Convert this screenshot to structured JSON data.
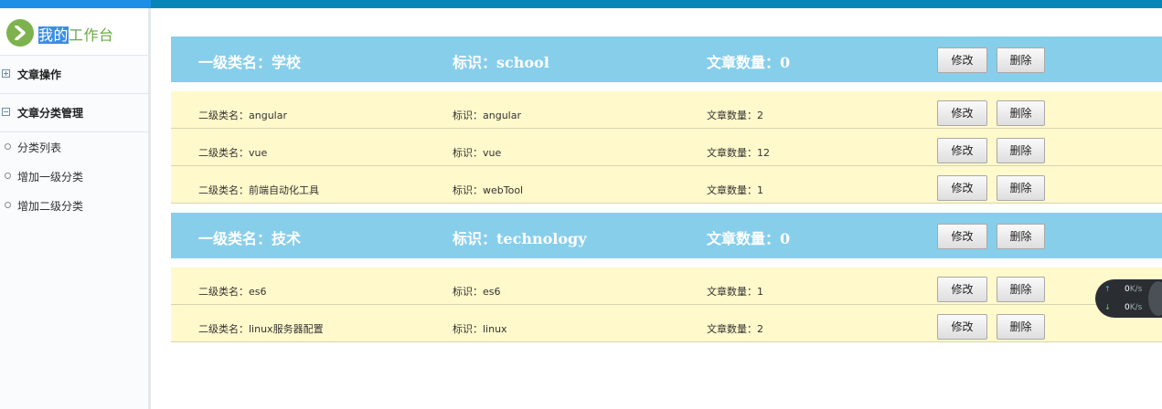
{
  "brand": {
    "selected": "我的",
    "rest": "工作台"
  },
  "sidebar": {
    "groups": [
      {
        "label": "文章操作",
        "state": "collapsed"
      },
      {
        "label": "文章分类管理",
        "state": "expanded"
      }
    ],
    "items": [
      {
        "label": "分类列表"
      },
      {
        "label": "增加一级分类"
      },
      {
        "label": "增加二级分类"
      }
    ]
  },
  "buttons": {
    "edit": "修改",
    "delete": "删除"
  },
  "categories": [
    {
      "name": "一级类名：学校",
      "tag": "标识：school",
      "count": "文章数量：0",
      "children": [
        {
          "name": "二级类名：angular",
          "tag": "标识：angular",
          "count": "文章数量：2"
        },
        {
          "name": "二级类名：vue",
          "tag": "标识：vue",
          "count": "文章数量：12"
        },
        {
          "name": "二级类名：前端自动化工具",
          "tag": "标识：webTool",
          "count": "文章数量：1"
        }
      ]
    },
    {
      "name": "一级类名：技术",
      "tag": "标识：technology",
      "count": "文章数量：0",
      "children": [
        {
          "name": "二级类名：es6",
          "tag": "标识：es6",
          "count": "文章数量：1"
        },
        {
          "name": "二级类名：linux服务器配置",
          "tag": "标识：linux",
          "count": "文章数量：2"
        }
      ]
    }
  ],
  "network": {
    "up": "0",
    "down": "0",
    "unit": "K/s"
  },
  "colors": {
    "primary_row": "#87ceeb",
    "secondary_row": "#fff9cb",
    "brand": "#7db24e",
    "topbar": "#0586b6"
  }
}
